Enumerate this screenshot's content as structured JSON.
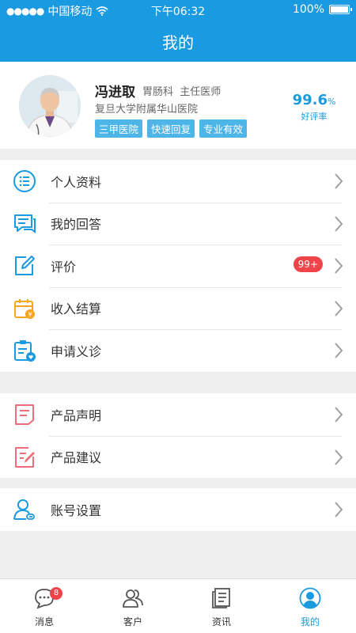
{
  "status_bar": {
    "carrier": "中国移动",
    "time": "下午06:32",
    "battery": "100%"
  },
  "header": {
    "title": "我的"
  },
  "profile": {
    "name": "冯进取",
    "department": "胃肠科",
    "position": "主任医师",
    "hospital": "复旦大学附属华山医院",
    "tags": [
      "三甲医院",
      "快速回复",
      "专业有效"
    ],
    "rating_value": "99.6",
    "rating_unit": "%",
    "rating_label": "好评率"
  },
  "menu_group1": [
    {
      "label": "个人资料",
      "icon": "list-icon"
    },
    {
      "label": "我的回答",
      "icon": "chat-icon"
    },
    {
      "label": "评价",
      "icon": "edit-icon",
      "badge": "99+"
    },
    {
      "label": "收入结算",
      "icon": "calendar-yen-icon"
    },
    {
      "label": "申请义诊",
      "icon": "clipboard-heart-icon"
    }
  ],
  "menu_group2": [
    {
      "label": "产品声明",
      "icon": "document-icon"
    },
    {
      "label": "产品建议",
      "icon": "document-edit-icon"
    }
  ],
  "menu_group3": [
    {
      "label": "账号设置",
      "icon": "user-link-icon"
    }
  ],
  "tabbar": [
    {
      "label": "消息",
      "icon": "message-icon",
      "badge": "8"
    },
    {
      "label": "客户",
      "icon": "customers-icon"
    },
    {
      "label": "资讯",
      "icon": "news-icon"
    },
    {
      "label": "我的",
      "icon": "profile-icon"
    }
  ],
  "colors": {
    "primary": "#1a9ae0",
    "badge": "#f0434a",
    "tag": "#4db5e8",
    "orange": "#f5a623",
    "pink": "#ef6c7a"
  }
}
